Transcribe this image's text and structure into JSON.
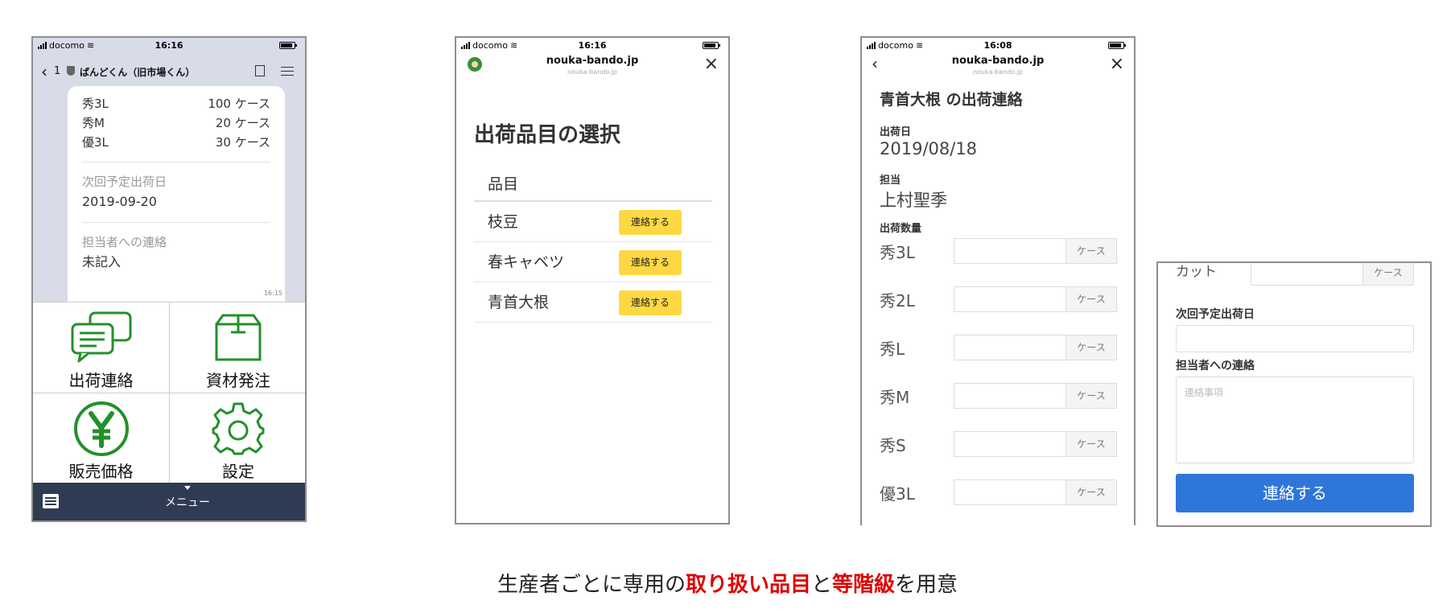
{
  "colors": {
    "line_green": "#23902a",
    "menu_bar": "#2f3b52",
    "yellow_button": "#fed843",
    "blue_button": "#2f76d9",
    "highlight_red": "#e00000"
  },
  "status": [
    {
      "carrier": "docomo",
      "time": "16:16"
    },
    {
      "carrier": "docomo",
      "time": "16:16"
    },
    {
      "carrier": "docomo",
      "time": "16:08"
    }
  ],
  "phone1": {
    "header": {
      "unread": "1",
      "title": "ばんどくん（旧市場くん）"
    },
    "bubble": {
      "rows": [
        {
          "grade": "秀3L",
          "qty": "100 ケース"
        },
        {
          "grade": "秀M",
          "qty": "20 ケース"
        },
        {
          "grade": "優3L",
          "qty": "30 ケース"
        }
      ],
      "next_date_label": "次回予定出荷日",
      "next_date_value": "2019-09-20",
      "contact_label": "担当者への連絡",
      "contact_value": "未記入"
    },
    "timestamp": "16:15",
    "menu": [
      "出荷連絡",
      "資材発注",
      "販売価格",
      "設定"
    ],
    "menu_icons": [
      "chat-bubbles-icon",
      "box-icon",
      "yen-icon",
      "gear-icon"
    ],
    "bottom_label": "メニュー"
  },
  "phone2": {
    "domain": "nouka-bando.jp",
    "subdomain": "nouka-bando.jp",
    "title": "出荷品目の選択",
    "table_header": "品目",
    "items": [
      "枝豆",
      "春キャベツ",
      "青首大根"
    ],
    "button_label": "連絡する"
  },
  "phone3": {
    "domain": "nouka-bando.jp",
    "subdomain": "nouka-bando.jp",
    "title": "青首大根 の出荷連絡",
    "date_label": "出荷日",
    "date_value": "2019/08/18",
    "person_label": "担当",
    "person_value": "上村聖季",
    "qty_label": "出荷数量",
    "grades": [
      "秀3L",
      "秀2L",
      "秀L",
      "秀M",
      "秀S",
      "優3L"
    ],
    "unit": "ケース"
  },
  "panel4": {
    "cut_label": "カット",
    "unit": "ケース",
    "next_date_label": "次回予定出荷日",
    "contact_label": "担当者への連絡",
    "contact_placeholder": "連絡事項",
    "submit_label": "連絡する"
  },
  "caption": {
    "pre": "生産者ごとに専用の",
    "hl1": "取り扱い品目",
    "mid": "と",
    "hl2": "等階級",
    "post": "を用意"
  }
}
